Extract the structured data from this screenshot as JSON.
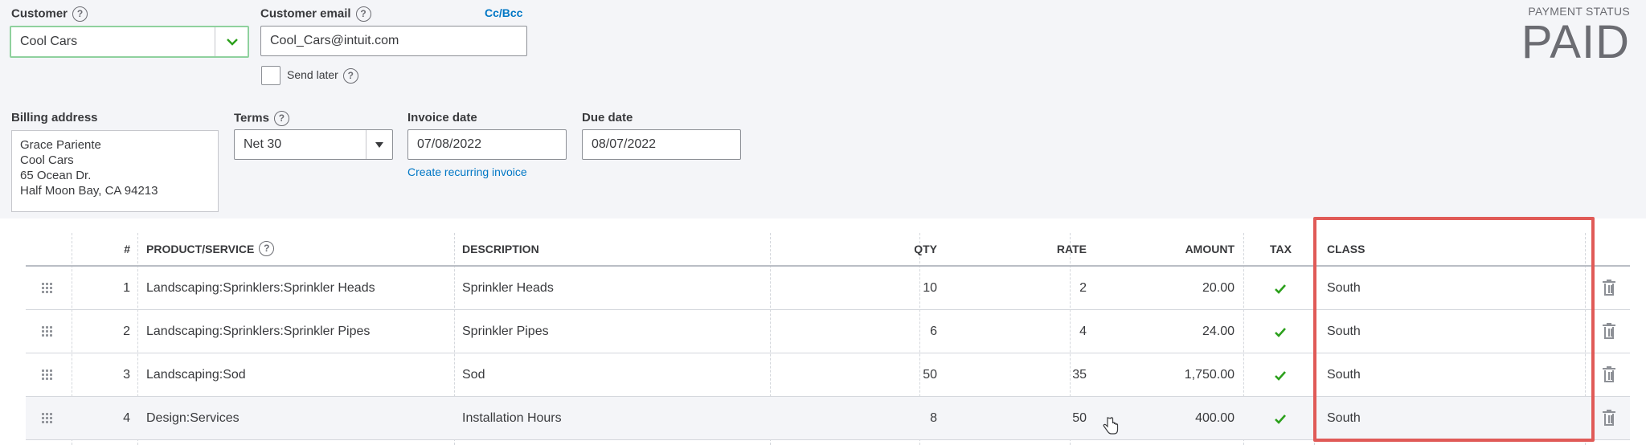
{
  "header": {
    "customer_label": "Customer",
    "customer_value": "Cool Cars",
    "email_label": "Customer email",
    "email_value": "Cool_Cars@intuit.com",
    "cc_bcc_link": "Cc/Bcc",
    "send_later_label": "Send later",
    "payment_status_label": "PAYMENT STATUS",
    "payment_status_value": "PAID"
  },
  "billing": {
    "label": "Billing address",
    "lines": [
      "Grace Pariente",
      "Cool Cars",
      "65 Ocean Dr.",
      "Half Moon Bay, CA  94213"
    ]
  },
  "terms": {
    "label": "Terms",
    "value": "Net 30"
  },
  "invoice_date": {
    "label": "Invoice date",
    "value": "07/08/2022"
  },
  "due_date": {
    "label": "Due date",
    "value": "08/07/2022"
  },
  "recurring_link": "Create recurring invoice",
  "table": {
    "columns": {
      "num": "#",
      "product": "PRODUCT/SERVICE",
      "description": "DESCRIPTION",
      "qty": "QTY",
      "rate": "RATE",
      "amount": "AMOUNT",
      "tax": "TAX",
      "class": "CLASS"
    },
    "rows": [
      {
        "num": "1",
        "product": "Landscaping:Sprinklers:Sprinkler Heads",
        "description": "Sprinkler Heads",
        "qty": "10",
        "rate": "2",
        "amount": "20.00",
        "class": "South"
      },
      {
        "num": "2",
        "product": "Landscaping:Sprinklers:Sprinkler Pipes",
        "description": "Sprinkler Pipes",
        "qty": "6",
        "rate": "4",
        "amount": "24.00",
        "class": "South"
      },
      {
        "num": "3",
        "product": "Landscaping:Sod",
        "description": "Sod",
        "qty": "50",
        "rate": "35",
        "amount": "1,750.00",
        "class": "South"
      },
      {
        "num": "4",
        "product": "Design:Services",
        "description": "Installation Hours",
        "qty": "8",
        "rate": "50",
        "amount": "400.00",
        "class": "South"
      }
    ]
  },
  "colors": {
    "link": "#0077c5",
    "check": "#2ca01c",
    "highlight": "#e05a57",
    "customer_border": "#8fd19e"
  }
}
